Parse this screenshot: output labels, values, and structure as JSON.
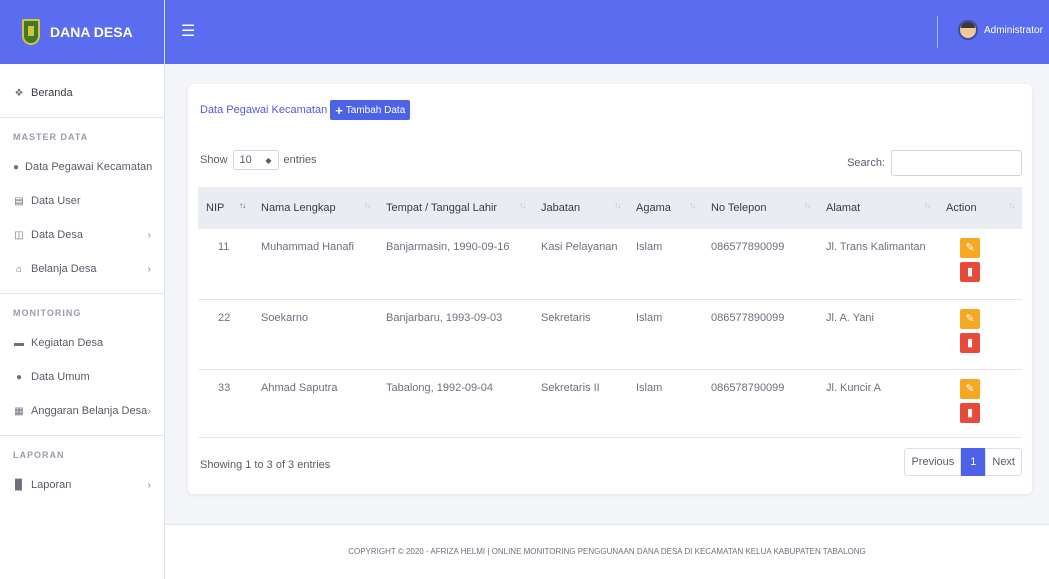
{
  "brand": {
    "title": "DANA DESA"
  },
  "topbar": {
    "menu_icon": "bars-icon",
    "user_name": "Administrator"
  },
  "sidebar": {
    "home": {
      "label": "Beranda",
      "icon": "dashboard-icon"
    },
    "sections": [
      {
        "heading": "MASTER DATA"
      },
      {
        "heading": "MONITORING"
      },
      {
        "heading": "LAPORAN"
      }
    ],
    "items": [
      {
        "label": "Data Pegawai Kecamatan",
        "icon": "person-icon"
      },
      {
        "label": "Data User",
        "icon": "file-icon"
      },
      {
        "label": "Data Desa",
        "icon": "grid-icon"
      },
      {
        "label": "Belanja Desa",
        "icon": "home-icon"
      },
      {
        "label": "Kegiatan Desa",
        "icon": "folder-icon"
      },
      {
        "label": "Data Umum",
        "icon": "person-icon"
      },
      {
        "label": "Anggaran Belanja Desa",
        "icon": "table-icon"
      },
      {
        "label": "Laporan",
        "icon": "bar-chart-icon"
      }
    ]
  },
  "card": {
    "title": "Data Pegawai Kecamatan",
    "add_button": "Tambah Data",
    "show_label": "Show",
    "entries_value": "10",
    "entries_label": "entries",
    "search_label": "Search:",
    "search_value": ""
  },
  "table": {
    "headers": [
      "NIP",
      "Nama Lengkap",
      "Tempat / Tanggal Lahir",
      "Jabatan",
      "Agama",
      "No Telepon",
      "Alamat",
      "Action"
    ],
    "rows": [
      {
        "nip": "11",
        "nama": "Muhammad Hanafi",
        "ttl": "Banjarmasin, 1990-09-16",
        "jabatan": "Kasi Pelayanan",
        "agama": "Islam",
        "telepon": "086577890099",
        "alamat": "Jl. Trans Kalimantan"
      },
      {
        "nip": "22",
        "nama": "Soekarno",
        "ttl": "Banjarbaru, 1993-09-03",
        "jabatan": "Sekretaris",
        "agama": "Islam",
        "telepon": "086577890099",
        "alamat": "Jl. A. Yani"
      },
      {
        "nip": "33",
        "nama": "Ahmad Saputra",
        "ttl": "Tabalong, 1992-09-04",
        "jabatan": "Sekretaris II",
        "agama": "Islam",
        "telepon": "086578790099",
        "alamat": "Jl. Kuncir A"
      }
    ]
  },
  "pagination": {
    "info": "Showing 1 to 3 of 3 entries",
    "previous": "Previous",
    "current": "1",
    "next": "Next"
  },
  "footer": {
    "text": "COPYRIGHT © 2020 - AFRIZA HELMI | ONLINE MONITORING PENGGUNAAN DANA DESA DI KECAMATAN KELUA KABUPATEN TABALONG"
  },
  "colors": {
    "primary": "#5a6cf0",
    "button": "#4e62e8",
    "edit": "#f6a820",
    "delete": "#e74a3b"
  }
}
